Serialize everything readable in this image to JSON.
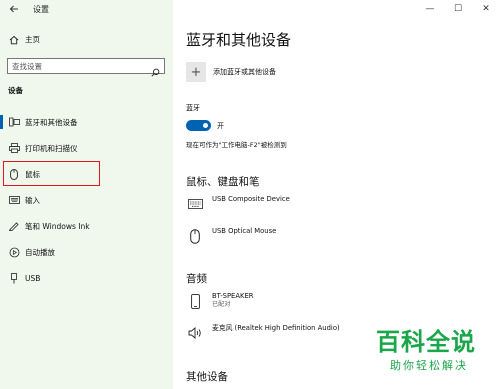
{
  "window": {
    "title": "设置",
    "controls": [
      "—",
      "☐",
      "✕"
    ]
  },
  "sidebar": {
    "home_label": "主页",
    "search": {
      "placeholder": "查找设置"
    },
    "section_label": "设备",
    "items": [
      {
        "label": "蓝牙和其他设备",
        "icon": "bluetooth-devices-icon",
        "selected": true
      },
      {
        "label": "打印机和扫描仪",
        "icon": "printer-icon",
        "selected": false
      },
      {
        "label": "鼠标",
        "icon": "mouse-icon",
        "selected": false,
        "highlighted": true
      },
      {
        "label": "输入",
        "icon": "keyboard-icon",
        "selected": false
      },
      {
        "label": "笔和 Windows Ink",
        "icon": "pen-icon",
        "selected": false
      },
      {
        "label": "自动播放",
        "icon": "autoplay-icon",
        "selected": false
      },
      {
        "label": "USB",
        "icon": "usb-icon",
        "selected": false
      }
    ],
    "accent_color": "#0063b1",
    "highlight_color": "#e0191e"
  },
  "main": {
    "page_title": "蓝牙和其他设备",
    "add_device_label": "添加蓝牙或其他设备",
    "bluetooth": {
      "label": "蓝牙",
      "state_label": "开",
      "on": true,
      "discoverable_text": "现在可作为\"工作电脑-F2\"被检测到"
    },
    "groups": {
      "mouse_keyboard_pen": {
        "heading": "鼠标、键盘和笔",
        "devices": [
          {
            "name": "USB Composite Device",
            "icon": "keyboard-icon"
          },
          {
            "name": "USB Optical Mouse",
            "icon": "mouse-icon"
          }
        ]
      },
      "audio": {
        "heading": "音频",
        "devices": [
          {
            "name": "BT-SPEAKER",
            "status": "已配对",
            "icon": "phone-icon"
          },
          {
            "name": "麦克风 (Realtek High Definition Audio)",
            "icon": "speaker-icon"
          }
        ]
      },
      "other": {
        "heading": "其他设备"
      }
    }
  },
  "watermark": {
    "main": "百科全说",
    "sub": "助你轻松解决",
    "color": "#1aa64a"
  }
}
